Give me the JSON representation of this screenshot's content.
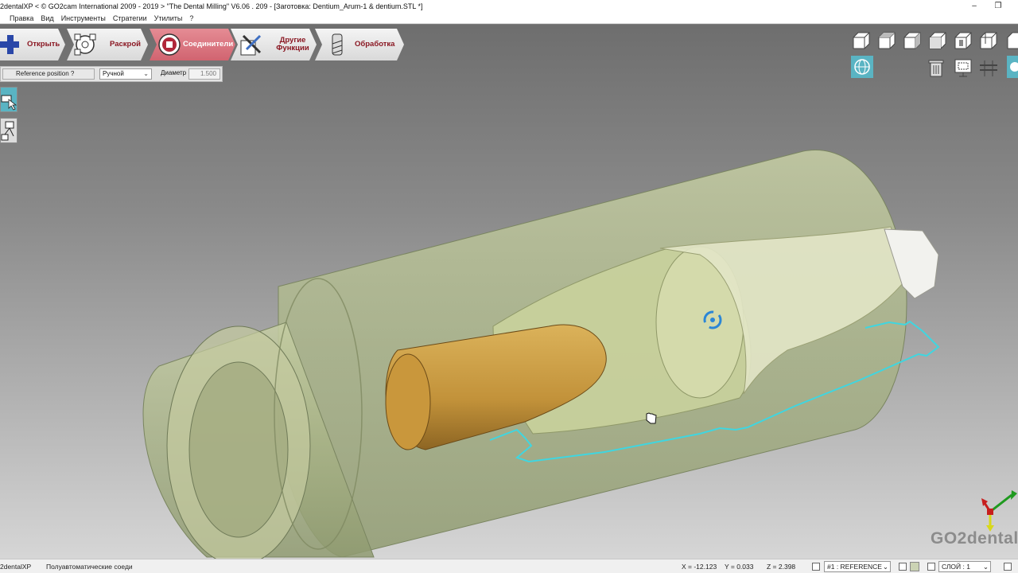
{
  "window": {
    "title": "2dentalXP < © GO2cam International 2009 - 2019 >     \"The Dental Milling\"   V6.06 . 209 - [Заготовка: Dentium_Arum-1 & dentium.STL *]",
    "minimize": "–",
    "restore": "❐"
  },
  "menu": {
    "items": [
      "Правка",
      "Вид",
      "Инструменты",
      "Стратегии",
      "Утилиты",
      "?"
    ]
  },
  "ribbon": {
    "tabs": [
      {
        "label": "Открыть",
        "icon": "plus-icon"
      },
      {
        "label": "Раскрой",
        "icon": "nesting-icon"
      },
      {
        "label": "Соединители",
        "icon": "connector-icon",
        "active": true
      },
      {
        "label": "Другие Функции",
        "icon": "tools-icon"
      },
      {
        "label": "Обработка",
        "icon": "milling-cutter-icon"
      }
    ]
  },
  "params": {
    "reference_button": "Reference position ?",
    "mode_select": "Ручной",
    "diameter_label": "Диаметр",
    "diameter_value": "1.500"
  },
  "status": {
    "app": "2dentalXP",
    "message": "Полуавтоматические соеди",
    "x": "X = -12.123",
    "y": "Y = 0.033",
    "z": "Z = 2.398",
    "reference": "#1 : REFERENCE",
    "layer": "СЛОЙ : 1"
  },
  "watermark": {
    "text": "GO2dental"
  },
  "colors": {
    "active_tab": "#d16470",
    "accent": "#5ab4c3",
    "toolpath": "#3fd6e0",
    "implant": "#c79a3c",
    "stock": "#b9c39a"
  }
}
